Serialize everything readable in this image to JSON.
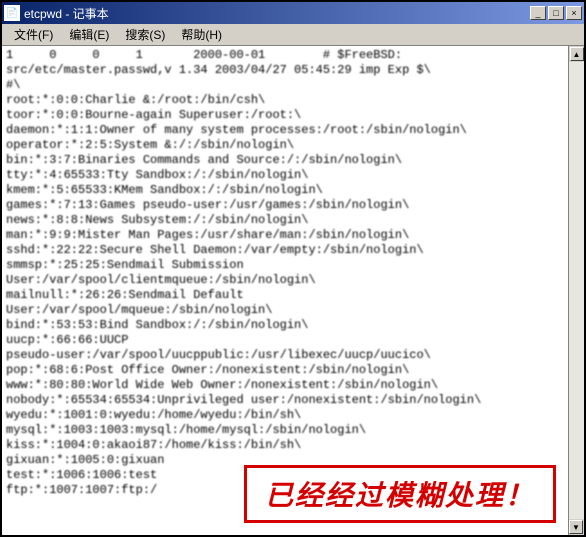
{
  "titlebar": {
    "icon": "📄",
    "title": "etcpwd - 记事本"
  },
  "titlebar_buttons": {
    "minimize": "_",
    "maximize": "□",
    "close": "×"
  },
  "menubar": {
    "file": "文件(F)",
    "edit": "编辑(E)",
    "search": "搜索(S)",
    "help": "帮助(H)"
  },
  "scrollbar": {
    "up": "▲",
    "down": "▼"
  },
  "content": {
    "lines": [
      "1     0     0     1       2000-00-01        # $FreeBSD:",
      "src/etc/master.passwd,v 1.34 2003/04/27 05:45:29 imp Exp $\\",
      "#\\",
      "root:*:0:0:Charlie &:/root:/bin/csh\\",
      "toor:*:0:0:Bourne-again Superuser:/root:\\",
      "daemon:*:1:1:Owner of many system processes:/root:/sbin/nologin\\",
      "operator:*:2:5:System &:/:/sbin/nologin\\",
      "bin:*:3:7:Binaries Commands and Source:/:/sbin/nologin\\",
      "tty:*:4:65533:Tty Sandbox:/:/sbin/nologin\\",
      "kmem:*:5:65533:KMem Sandbox:/:/sbin/nologin\\",
      "games:*:7:13:Games pseudo-user:/usr/games:/sbin/nologin\\",
      "news:*:8:8:News Subsystem:/:/sbin/nologin\\",
      "man:*:9:9:Mister Man Pages:/usr/share/man:/sbin/nologin\\",
      "sshd:*:22:22:Secure Shell Daemon:/var/empty:/sbin/nologin\\",
      "smmsp:*:25:25:Sendmail Submission",
      "User:/var/spool/clientmqueue:/sbin/nologin\\",
      "mailnull:*:26:26:Sendmail Default",
      "User:/var/spool/mqueue:/sbin/nologin\\",
      "bind:*:53:53:Bind Sandbox:/:/sbin/nologin\\",
      "uucp:*:66:66:UUCP",
      "pseudo-user:/var/spool/uucppublic:/usr/libexec/uucp/uucico\\",
      "pop:*:68:6:Post Office Owner:/nonexistent:/sbin/nologin\\",
      "www:*:80:80:World Wide Web Owner:/nonexistent:/sbin/nologin\\",
      "nobody:*:65534:65534:Unprivileged user:/nonexistent:/sbin/nologin\\",
      "wyedu:*:1001:0:wyedu:/home/wyedu:/bin/sh\\",
      "mysql:*:1003:1003:mysql:/home/mysql:/sbin/nologin\\",
      "kiss:*:1004:0:akaoi87:/home/kiss:/bin/sh\\",
      "gixuan:*:1005:0:gixuan",
      "test:*:1006:1006:test",
      "ftp:*:1007:1007:ftp:/"
    ]
  },
  "overlay": {
    "text": "已经经过模糊处理！"
  }
}
